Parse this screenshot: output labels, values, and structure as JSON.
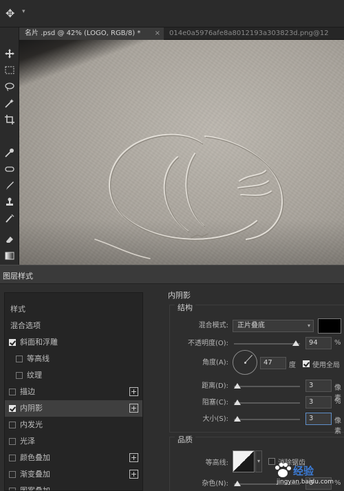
{
  "options_bar": {
    "tool_icon": "move-tool-icon"
  },
  "tabs": [
    {
      "label": "名片 .psd @ 42% (LOGO, RGB/8) *",
      "active": true,
      "close": "×"
    },
    {
      "label": "014e0a5976afe8a8012193a303823d.png@12",
      "active": false
    }
  ],
  "toolbar": {
    "tools": [
      "move-tool-icon",
      "marquee-tool-icon",
      "lasso-tool-icon",
      "magic-wand-icon",
      "crop-tool-icon",
      "eyedropper-icon",
      "healing-brush-icon",
      "brush-tool-icon",
      "clone-stamp-icon",
      "history-brush-icon",
      "eraser-icon",
      "gradient-tool-icon"
    ]
  },
  "dialog": {
    "title": "图层样式",
    "style_list": {
      "header1": "样式",
      "header2": "混合选项",
      "items": [
        {
          "label": "斜面和浮雕",
          "checked": true,
          "indent": false,
          "plus": false
        },
        {
          "label": "等高线",
          "checked": false,
          "indent": true,
          "plus": false
        },
        {
          "label": "纹理",
          "checked": false,
          "indent": true,
          "plus": false
        },
        {
          "label": "描边",
          "checked": false,
          "indent": false,
          "plus": true
        },
        {
          "label": "内阴影",
          "checked": true,
          "indent": false,
          "plus": true,
          "selected": true
        },
        {
          "label": "内发光",
          "checked": false,
          "indent": false,
          "plus": false
        },
        {
          "label": "光泽",
          "checked": false,
          "indent": false,
          "plus": false
        },
        {
          "label": "颜色叠加",
          "checked": false,
          "indent": false,
          "plus": true
        },
        {
          "label": "渐变叠加",
          "checked": false,
          "indent": false,
          "plus": true
        },
        {
          "label": "图案叠加",
          "checked": false,
          "indent": false,
          "plus": false
        }
      ]
    },
    "inner_shadow": {
      "title": "内阴影",
      "structure_title": "结构",
      "blend_mode_label": "混合模式:",
      "blend_mode_value": "正片叠底",
      "blend_color": "#000000",
      "opacity_label": "不透明度(O):",
      "opacity_value": "94",
      "opacity_unit": "%",
      "opacity_level": 0.94,
      "angle_label": "角度(A):",
      "angle_value": "47",
      "angle_unit": "度",
      "global_light_label": "使用全局",
      "global_light_checked": true,
      "distance_label": "距离(D):",
      "distance_value": "3",
      "distance_unit": "像素",
      "choke_label": "阻塞(C):",
      "choke_value": "3",
      "choke_unit": "%",
      "size_label": "大小(S):",
      "size_value": "3",
      "size_unit": "像素",
      "quality_title": "品质",
      "contour_label": "等高线:",
      "anti_alias_label": "消除锯齿",
      "noise_label": "杂色(N):",
      "noise_value": "0",
      "noise_unit": "%"
    }
  },
  "watermark": {
    "brand": "经验",
    "url": "jingyan.baidu.com"
  }
}
